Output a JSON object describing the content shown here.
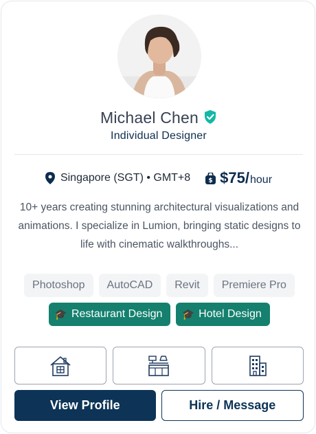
{
  "profile": {
    "name": "Michael Chen",
    "title": "Individual Designer",
    "location": "Singapore (SGT) • GMT+8",
    "rate": "$75/",
    "rate_unit": "hour",
    "bio": "10+ years creating stunning architectural visualizations and animations. I specialize in Lumion, bringing static designs to life with cinematic walkthroughs..."
  },
  "skills": [
    "Photoshop",
    "AutoCAD",
    "Revit",
    "Premiere Pro"
  ],
  "specializations": [
    "Restaurant Design",
    "Hotel Design"
  ],
  "categories": [
    "house-icon",
    "kitchen-icon",
    "building-icon"
  ],
  "actions": {
    "view_profile": "View Profile",
    "hire": "Hire / Message"
  },
  "colors": {
    "primary": "#0d3457",
    "accent": "#15806e",
    "verified": "#14b8a6"
  }
}
